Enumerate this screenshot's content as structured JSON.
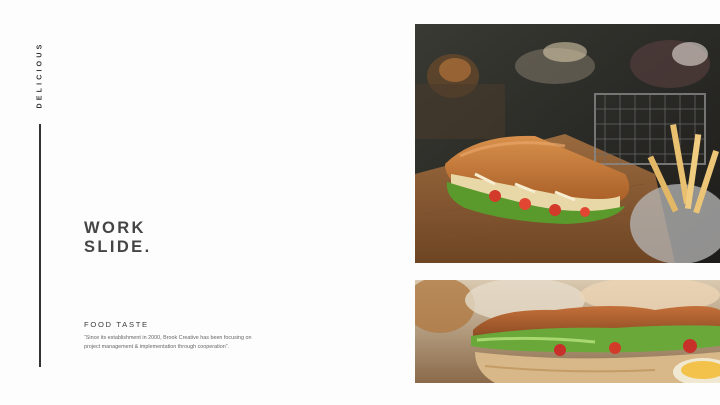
{
  "side_label": "DELICIOUS",
  "title": {
    "line1": "WORK",
    "line2": "SLIDE."
  },
  "subtitle": "FOOD TASTE",
  "description": "“Since its establishment in 2000, Brook Creative has been focusing on project management & implementation through cooperation”.",
  "colors": {
    "background": "#fdfdfd",
    "accent_line": "#333333",
    "title": "#454545"
  }
}
